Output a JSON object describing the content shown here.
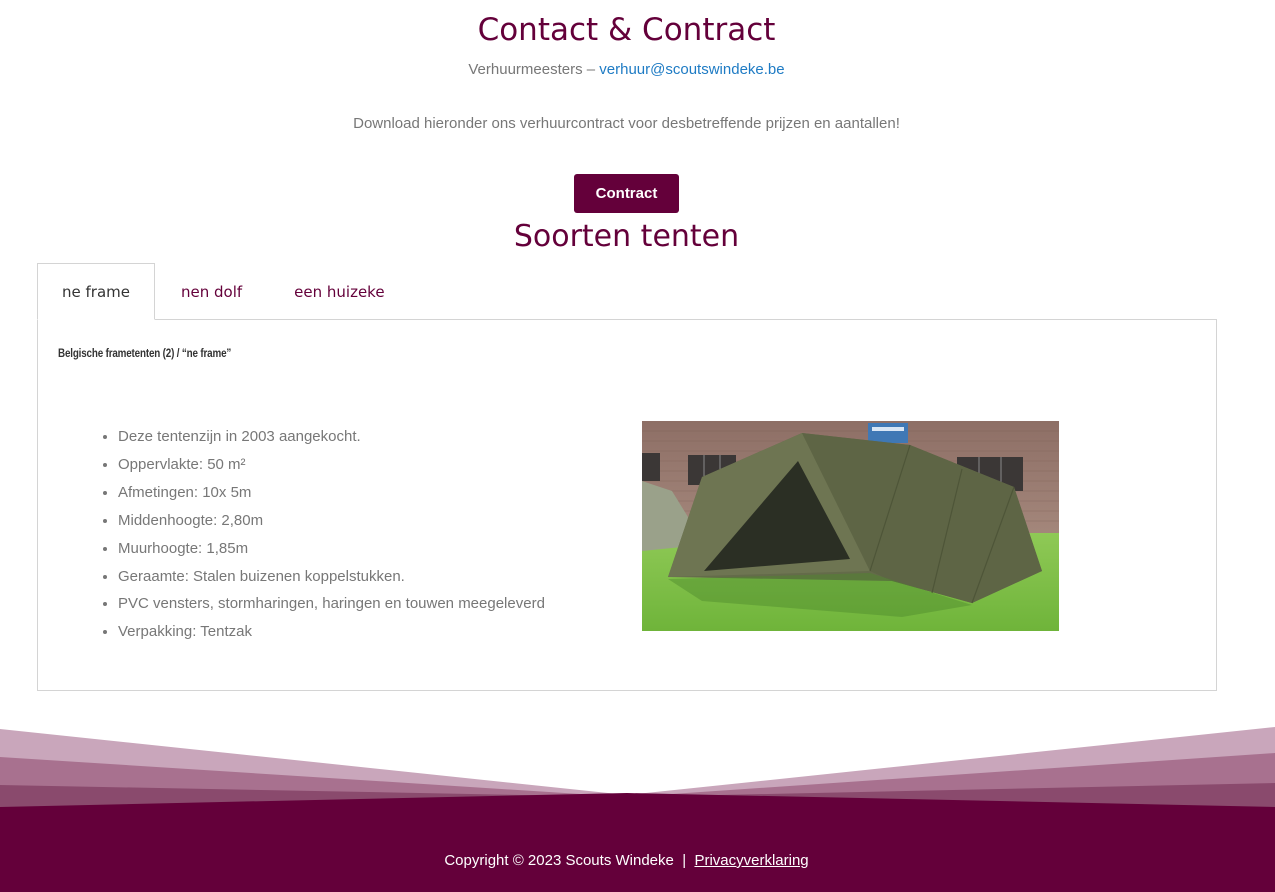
{
  "contact": {
    "title": "Contact & Contract",
    "prefix": "Verhuurmeesters – ",
    "email": "verhuur@scoutswindeke.be",
    "download_text": "Download hieronder ons verhuurcontract voor desbetreffende prijzen en aantallen!",
    "contract_button": "Contract"
  },
  "tents": {
    "title": "Soorten tenten",
    "tabs": [
      "ne frame",
      "nen dolf",
      "een huizeke"
    ],
    "active_tab": "ne frame",
    "panel": {
      "heading": "Belgische frametenten (2) / “ne frame”",
      "specs": [
        "Deze tentenzijn in 2003 aangekocht.",
        "Oppervlakte: 50 m²",
        "Afmetingen: 10x 5m",
        "Middenhoogte: 2,80m",
        "Muurhoogte: 1,85m",
        "Geraamte: Stalen buizenen koppelstukken.",
        "PVC vensters, stormharingen, haringen en touwen meegeleverd",
        "Verpakking: Tentzak"
      ]
    }
  },
  "footer": {
    "copyright": "Copyright © 2023 Scouts Windeke",
    "separator": "|",
    "privacy_link": "Privacyverklaring"
  },
  "colors": {
    "brand": "#64003a",
    "link": "#1e7bc4",
    "text": "#777777"
  }
}
